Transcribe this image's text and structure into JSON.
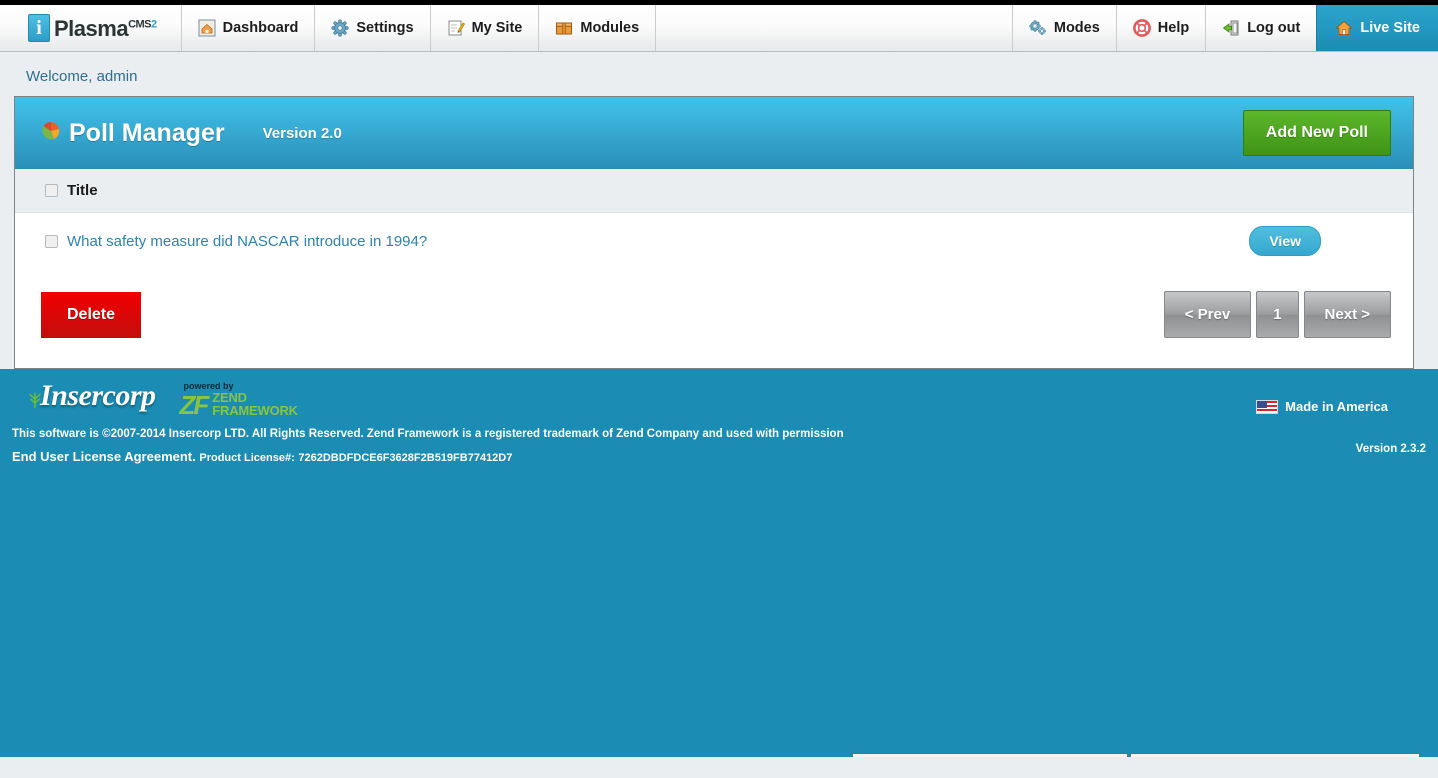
{
  "brand": {
    "mark_letter": "i",
    "name": "Plasma",
    "sup_cms": "CMS",
    "sup_two": "2"
  },
  "nav": {
    "left_items": [
      {
        "label": "Dashboard",
        "icon": "home-icon"
      },
      {
        "label": "Settings",
        "icon": "gear-icon"
      },
      {
        "label": "My Site",
        "icon": "pencil-note-icon"
      },
      {
        "label": "Modules",
        "icon": "box-icon"
      }
    ],
    "right_items": [
      {
        "label": "Modes",
        "icon": "gears-icon"
      },
      {
        "label": "Help",
        "icon": "lifering-icon"
      },
      {
        "label": "Log out",
        "icon": "exit-door-icon"
      },
      {
        "label": "Live Site",
        "icon": "house-icon"
      }
    ]
  },
  "welcome": "Welcome, admin",
  "page": {
    "title": "Poll Manager",
    "version": "Version 2.0",
    "add_button": "Add New Poll"
  },
  "table": {
    "columns": [
      "Title"
    ],
    "rows": [
      {
        "title": "What safety measure did NASCAR introduce in 1994?",
        "action": "View"
      }
    ]
  },
  "actions": {
    "delete_label": "Delete",
    "pagination": {
      "prev": "< Prev",
      "pages": [
        "1"
      ],
      "next": "Next >"
    }
  },
  "footer": {
    "company": "Insercorp",
    "powered_by": "powered by",
    "zend_mark": "ZF",
    "zend_word_1": "ZEND",
    "zend_word_2": "FRAMEWORK",
    "made_in_america": "Made in America",
    "copyright": "This software is ©2007-2014 Insercorp LTD. All Rights Reserved. Zend Framework is a registered trademark of Zend Company and used with permission",
    "eula": "End User License Agreement.",
    "license_label": "Product License#:",
    "license_key": "7262DBDFDCE6F3628F2B519FB77412D7",
    "version": "Version 2.3.2"
  },
  "colors": {
    "accent_blue": "#2a8fb8",
    "header_blue_top": "#41c2ea",
    "footer_teal": "#1b8cb3",
    "add_green": "#5cb72b",
    "delete_red": "#f20000",
    "page_bg": "#eaeef1",
    "link_blue": "#2c83b0"
  }
}
